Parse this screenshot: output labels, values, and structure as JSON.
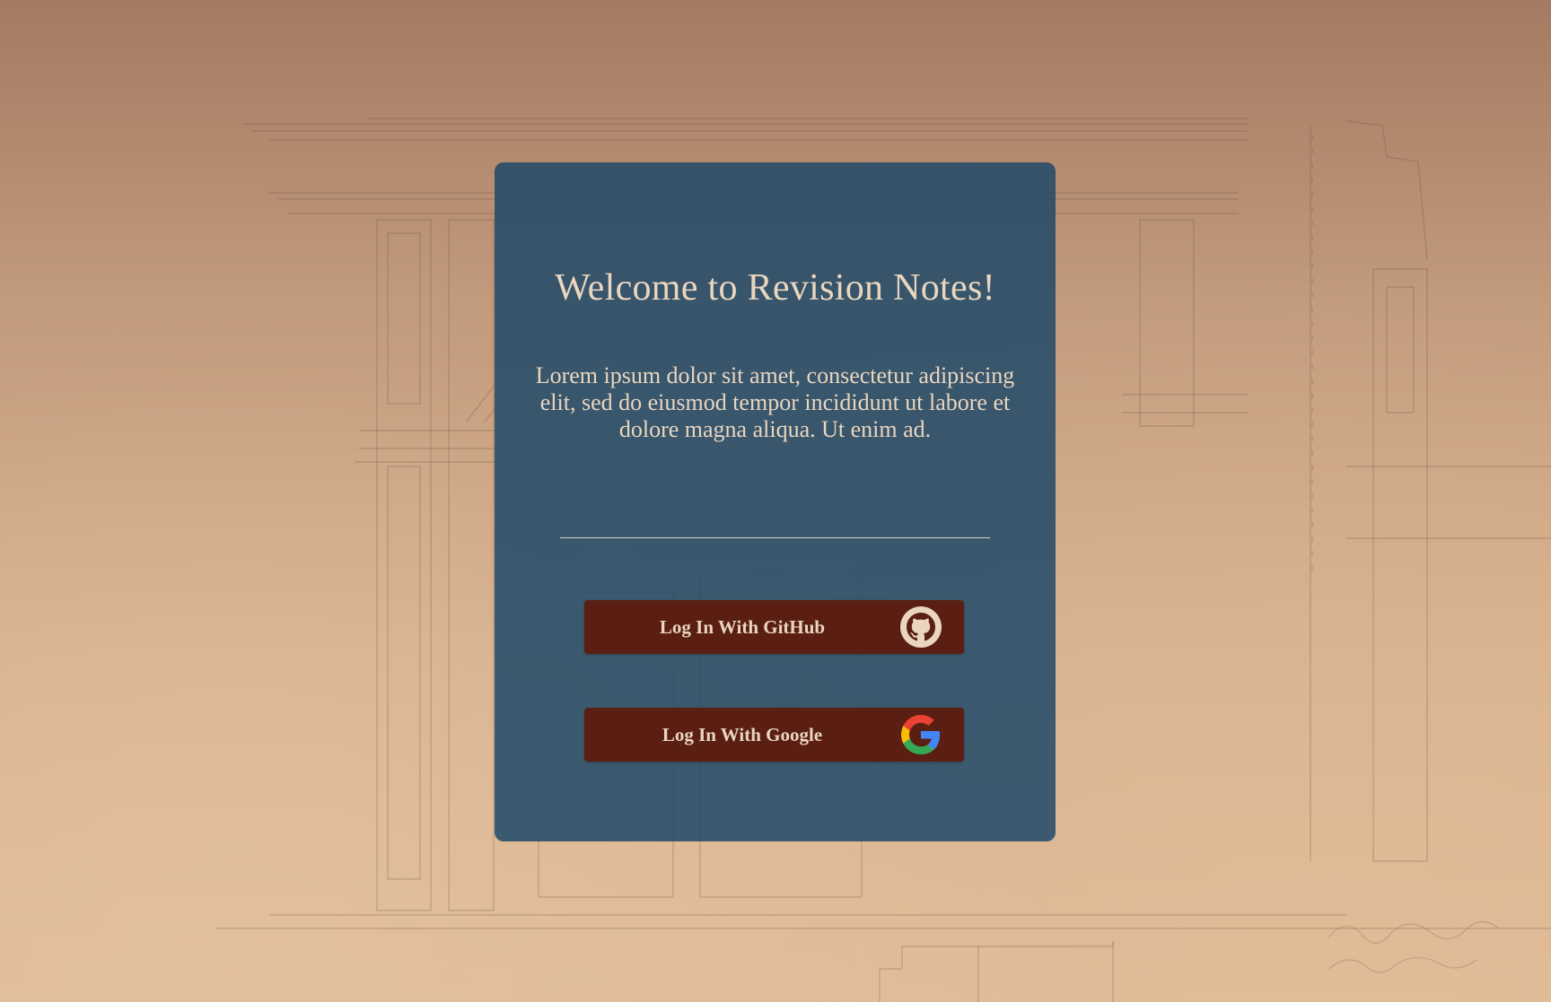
{
  "welcome": {
    "title": "Welcome to Revision Notes!",
    "intro": "Lorem ipsum dolor sit amet, consectetur adipiscing elit, sed do eiusmod tempor incididunt ut labore et dolore magna aliqua. Ut enim ad."
  },
  "login": {
    "github_label": "Log In With GitHub",
    "github_icon": "github-octocat-icon",
    "google_label": "Log In With Google",
    "google_icon": "google-g-icon"
  },
  "colors": {
    "card_background": "#1d4868",
    "button_background": "#5a1f12",
    "text": "#ead6bf"
  },
  "background": {
    "image": "architectural-drawing-of-building-facade"
  }
}
